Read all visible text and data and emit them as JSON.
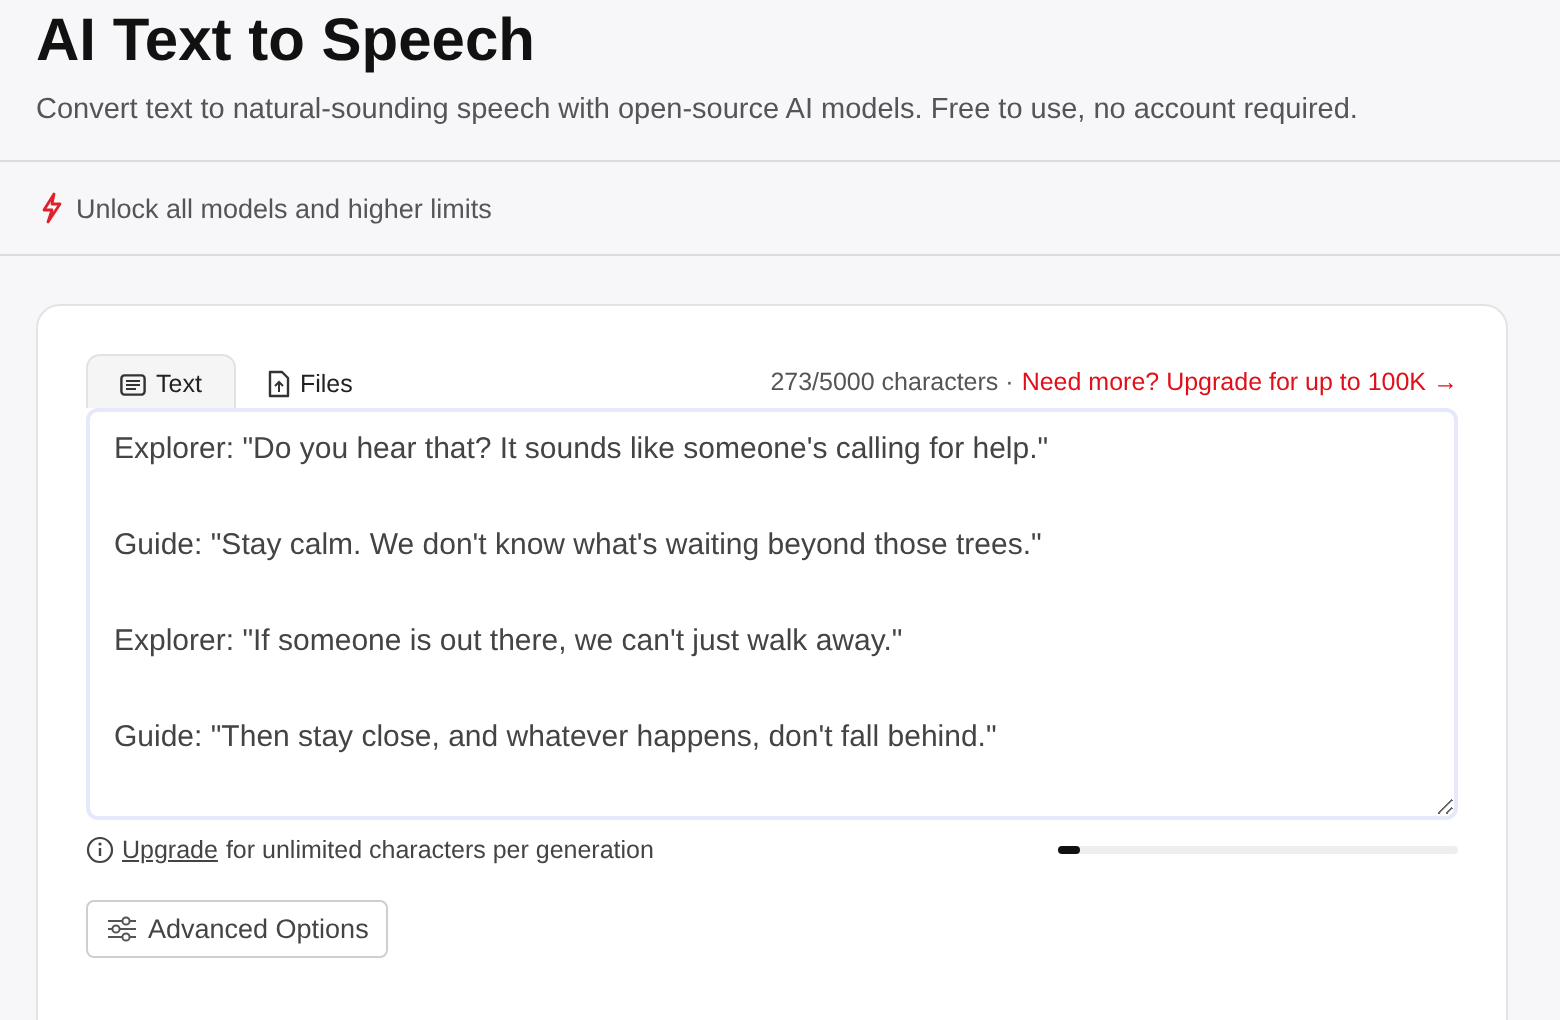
{
  "header": {
    "title": "AI Text to Speech",
    "subtitle": "Convert text to natural-sounding speech with open-source AI models. Free to use, no account required."
  },
  "banner": {
    "label": "Unlock all models and higher limits"
  },
  "tabs": [
    {
      "label": "Text",
      "kind": "text",
      "selected": true
    },
    {
      "label": "Files",
      "kind": "files",
      "selected": false
    }
  ],
  "counter": {
    "count": "273/5000 characters ·",
    "upgrade_link": "Need more? Upgrade for up to 100K →"
  },
  "editor": {
    "lines": [
      "Explorer: \"Do you hear that? It sounds like someone's calling for help.\"",
      "Guide: \"Stay calm. We don't know what's waiting beyond those trees.\"",
      "Explorer: \"If someone is out there, we can't just walk away.\"",
      "Guide: \"Then stay close, and whatever happens, don't fall behind.\""
    ]
  },
  "hint": {
    "link": "Upgrade",
    "text": "for unlimited characters per generation"
  },
  "usage": {
    "level": 0.055
  },
  "advanced_button": {
    "label": "Advanced Options"
  }
}
